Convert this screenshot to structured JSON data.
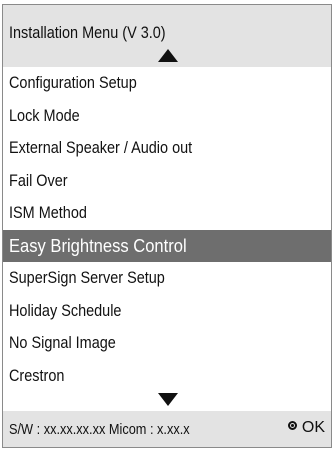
{
  "header": {
    "title": "Installation Menu (V 3.0)"
  },
  "menu": {
    "items": [
      {
        "label": "Configuration Setup"
      },
      {
        "label": "Lock Mode"
      },
      {
        "label": "External Speaker / Audio out"
      },
      {
        "label": "Fail Over"
      },
      {
        "label": "ISM Method"
      },
      {
        "label": "Easy Brightness Control",
        "selected": true
      },
      {
        "label": "SuperSign Server Setup"
      },
      {
        "label": "Holiday Schedule"
      },
      {
        "label": "No Signal Image"
      },
      {
        "label": "Crestron"
      }
    ]
  },
  "footer": {
    "version": "S/W : xx.xx.xx.xx Micom : x.xx.x",
    "ok_label": "OK"
  },
  "colors": {
    "panel": "#e3e3e3",
    "selected_bg": "#6e6e6e",
    "selected_text": "#ffffff"
  }
}
